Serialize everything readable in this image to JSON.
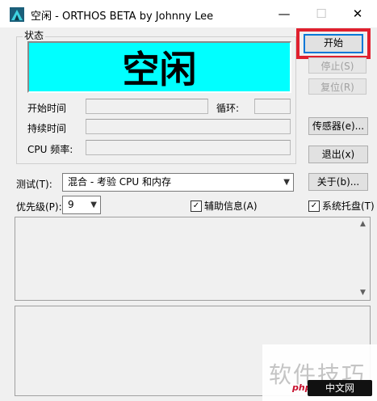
{
  "window": {
    "title": "空闲 - ORTHOS BETA by Johnny Lee",
    "minimize_glyph": "—",
    "maximize_glyph": "☐",
    "close_glyph": "✕"
  },
  "status": {
    "group_label": "状态",
    "display_text": "空闲",
    "display_color": "#00ffff"
  },
  "fields": {
    "start_time_label": "开始时间",
    "loop_label": "循环:",
    "duration_label": "持续时间",
    "cpu_freq_label": "CPU 频率:"
  },
  "buttons": {
    "start": "开始",
    "stop": "停止(S)",
    "reset": "复位(R)",
    "sensors": "传感器(e)...",
    "exit": "退出(x)",
    "about": "关于(b)..."
  },
  "test": {
    "label": "测试(T):",
    "selected": "混合 - 考验 CPU 和内存"
  },
  "priority": {
    "label": "优先级(P):",
    "selected": "9"
  },
  "checkboxes": {
    "aux_info": "辅助信息(A)",
    "system_tray": "系统托盘(T)"
  },
  "watermark": {
    "text": "软件技巧",
    "badge": "中文网",
    "php": "php"
  },
  "colors": {
    "highlight": "#e0202e",
    "accent": "#0078d7"
  }
}
